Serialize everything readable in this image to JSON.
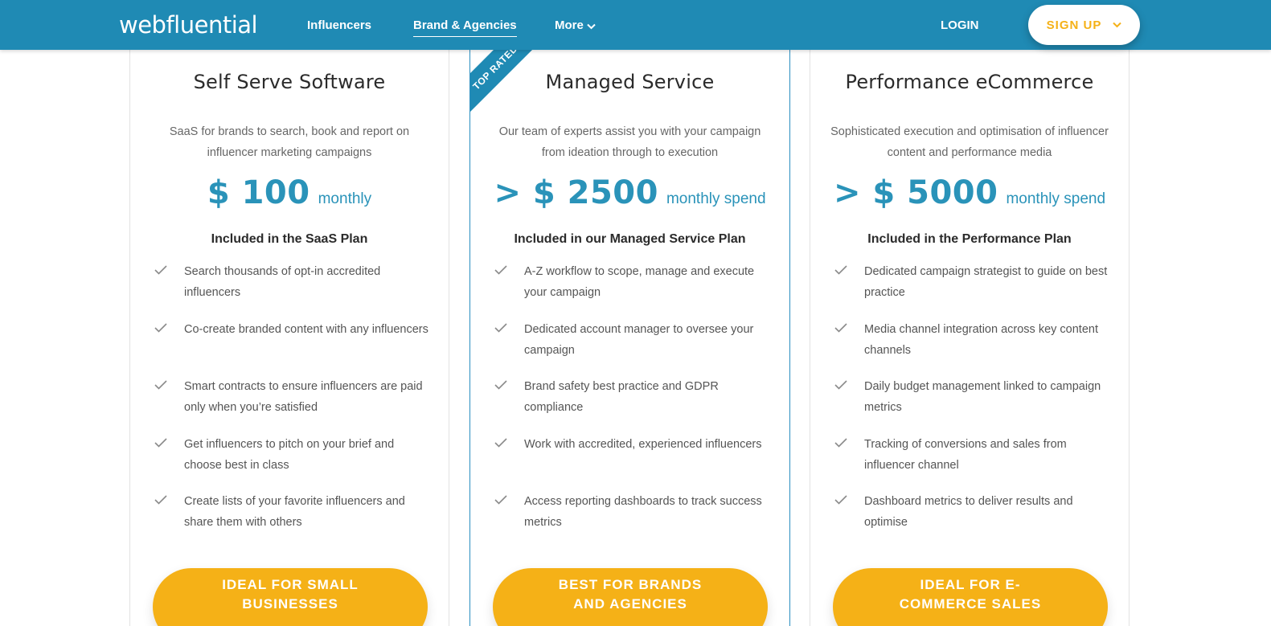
{
  "header": {
    "logo": "webfluential",
    "nav": {
      "influencers": "Influencers",
      "brand_agencies": "Brand & Agencies",
      "more": "More"
    },
    "login": "LOGIN",
    "signup": "SIGN UP"
  },
  "colors": {
    "header_bg": "#1f8ab4",
    "accent_teal": "#2a93b9",
    "cta_yellow": "#f5b117"
  },
  "plans": [
    {
      "title": "Self Serve Software",
      "description": "SaaS for brands to search, book and report on influencer marketing campaigns",
      "price": "$ 100",
      "price_unit": "monthly",
      "included_heading": "Included in the SaaS Plan",
      "features": [
        "Search thousands of opt-in accredited influencers",
        "Co-create branded content with any influencers",
        "Smart contracts to ensure influencers are paid only when you’re satisfied",
        "Get influencers to pitch on your brief and choose best in class",
        "Create lists of your favorite influencers and share them with others"
      ],
      "cta": "IDEAL FOR SMALL BUSINESSES"
    },
    {
      "ribbon": "TOP RATED",
      "title": "Managed Service",
      "description": "Our team of experts assist you with your campaign from ideation through to execution",
      "price": "> $ 2500",
      "price_unit": "monthly spend",
      "included_heading": "Included in our Managed Service Plan",
      "features": [
        "A-Z workflow to scope, manage and execute your campaign",
        "Dedicated account manager to oversee your campaign",
        "Brand safety best practice and GDPR compliance",
        "Work with accredited, experienced influencers",
        "Access reporting dashboards to track success metrics"
      ],
      "cta": "BEST FOR BRANDS AND AGENCIES"
    },
    {
      "title": "Performance eCommerce",
      "description": "Sophisticated execution and optimisation of influencer content and performance media",
      "price": "> $ 5000",
      "price_unit": "monthly spend",
      "included_heading": "Included in the Performance Plan",
      "features": [
        "Dedicated campaign strategist to guide on best practice",
        "Media channel integration across key content channels",
        "Daily budget management linked to campaign metrics",
        "Tracking of conversions and sales from influencer channel",
        "Dashboard metrics to deliver results and optimise"
      ],
      "cta": "IDEAL FOR E-COMMERCE SALES"
    }
  ]
}
